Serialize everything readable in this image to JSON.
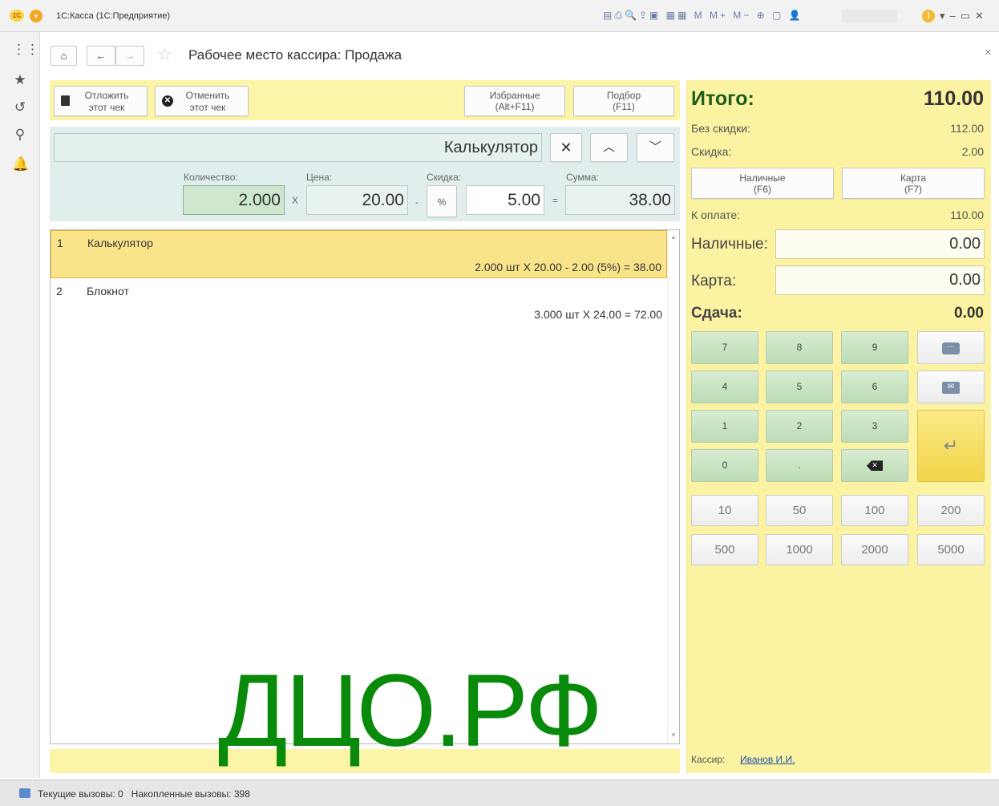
{
  "window": {
    "title": "1С:Касса  (1С:Предприятие)",
    "logo": "1С"
  },
  "page": {
    "title": "Рабочее место кассира: Продажа",
    "close": "×"
  },
  "toolbar": {
    "postpone": [
      "Отложить",
      "этот чек"
    ],
    "cancel": [
      "Отменить",
      "этот чек"
    ],
    "favorites": [
      "Избранные",
      "(Alt+F11)"
    ],
    "pick": [
      "Подбор",
      "(F11)"
    ]
  },
  "current_item": {
    "name": "Калькулятор",
    "qty_label": "Количество:",
    "qty": "2.000",
    "x_sign": "X",
    "price_label": "Цена:",
    "price": "20.00",
    "minus_sign": "-",
    "discount_label": "Скидка:",
    "percent": "%",
    "discount": "5.00",
    "eq_sign": "=",
    "sum_label": "Сумма:",
    "sum": "38.00"
  },
  "lines": [
    {
      "n": "1",
      "name": "Калькулятор",
      "calc": "2.000 шт X 20.00 - 2.00 (5%) = 38.00"
    },
    {
      "n": "2",
      "name": "Блокнот",
      "calc": "3.000 шт X 24.00 = 72.00"
    }
  ],
  "totals": {
    "total_label": "Итого:",
    "total": "110.00",
    "nodisc_label": "Без скидки:",
    "nodisc": "112.00",
    "disc_label": "Скидка:",
    "disc": "2.00",
    "cash_btn": [
      "Наличные",
      "(F6)"
    ],
    "card_btn": [
      "Карта",
      "(F7)"
    ],
    "topay_label": "К оплате:",
    "topay": "110.00",
    "cash_label": "Наличные:",
    "cash": "0.00",
    "card_label": "Карта:",
    "card": "0.00",
    "change_label": "Сдача:",
    "change": "0.00"
  },
  "numpad": {
    "keys": [
      "7",
      "8",
      "9",
      "4",
      "5",
      "6",
      "1",
      "2",
      "3",
      "0",
      "."
    ],
    "amounts": [
      "10",
      "50",
      "100",
      "200",
      "500",
      "1000",
      "2000",
      "5000"
    ]
  },
  "cashier": {
    "label": "Кассир:",
    "name": "Иванов И.И."
  },
  "status": {
    "text": "Текущие вызовы: 0   Накопленные вызовы: 398"
  },
  "watermark": "ДЦО.РФ",
  "colors": {
    "yellow_panel": "#fbf3a1",
    "green_key": "#c6e2bf",
    "selected_row": "#f9e48a",
    "accent_green": "#1e5c1e",
    "watermark": "#0a8a0a"
  }
}
